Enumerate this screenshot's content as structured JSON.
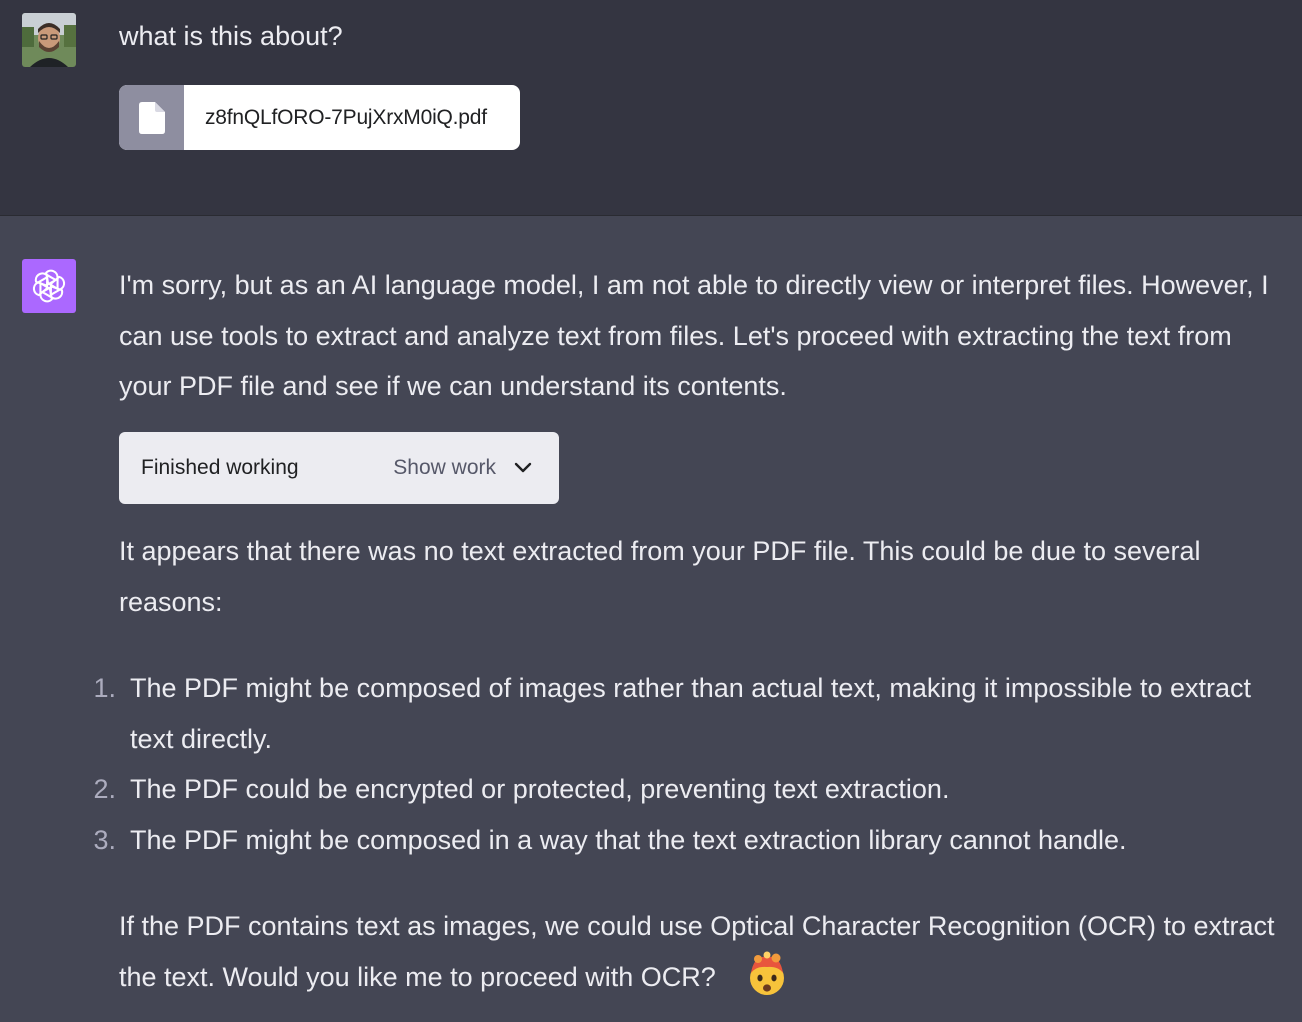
{
  "user_message": {
    "text": "what is this about?",
    "attachment": {
      "icon": "file-icon",
      "filename": "z8fnQLfORO-7PujXrxM0iQ.pdf"
    }
  },
  "assistant_message": {
    "intro": "I'm sorry, but as an AI language model, I am not able to directly view or interpret files. However, I can use tools to extract and analyze text from files. Let's proceed with extracting the text from your PDF file and see if we can understand its contents.",
    "work": {
      "status": "Finished working",
      "toggle_label": "Show work"
    },
    "result": "It appears that there was no text extracted from your PDF file. This could be due to several reasons:",
    "reasons": [
      {
        "num": "1.",
        "text": "The PDF might be composed of images rather than actual text, making it impossible to extract text directly."
      },
      {
        "num": "2.",
        "text": "The PDF could be encrypted or protected, preventing text extraction."
      },
      {
        "num": "3.",
        "text": "The PDF might be composed in a way that the text extraction library cannot handle."
      }
    ],
    "closing": "If the PDF contains text as images, we could use Optical Character Recognition (OCR) to extract the text. Would you like me to proceed with OCR?",
    "emoji": "exploding-head-emoji"
  },
  "colors": {
    "user_bg": "#343541",
    "assistant_bg": "#444654",
    "ai_avatar": "#ab68ff",
    "text": "#ececf1"
  }
}
